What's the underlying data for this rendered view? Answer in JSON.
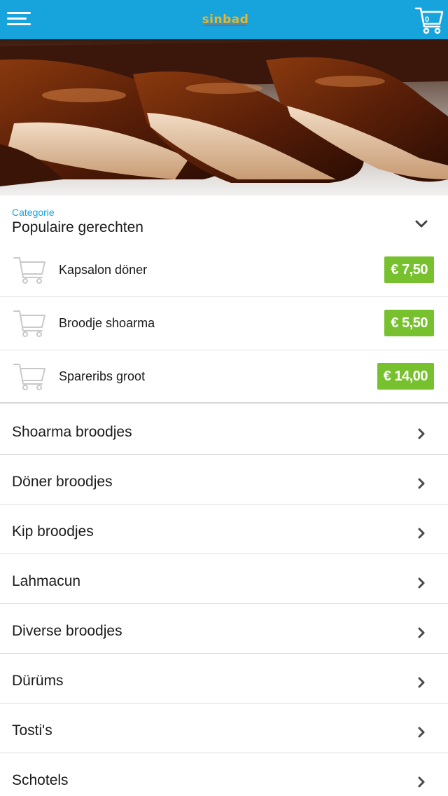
{
  "header": {
    "logo_text": "sinbad",
    "cart_count": "0",
    "icons": {
      "menu": "hamburger-menu-icon",
      "cart": "shopping-cart-icon"
    },
    "colors": {
      "bar": "#17a4dc",
      "logo": "#f3b21f"
    }
  },
  "category_selector": {
    "label": "Categorie",
    "selected": "Populaire gerechten",
    "icon": "chevron-down-icon"
  },
  "popular_items": [
    {
      "name": "Kapsalon döner",
      "price": "€ 7,50"
    },
    {
      "name": "Broodje shoarma",
      "price": "€ 5,50"
    },
    {
      "name": "Spareribs groot",
      "price": "€ 14,00"
    }
  ],
  "categories": [
    {
      "name": "Shoarma broodjes"
    },
    {
      "name": "Döner broodjes"
    },
    {
      "name": "Kip broodjes"
    },
    {
      "name": "Lahmacun"
    },
    {
      "name": "Diverse broodjes"
    },
    {
      "name": "Dürüms"
    },
    {
      "name": "Tosti's"
    },
    {
      "name": "Schotels"
    }
  ],
  "colors": {
    "accent": "#17a4dc",
    "price_badge": "#77c12f"
  }
}
